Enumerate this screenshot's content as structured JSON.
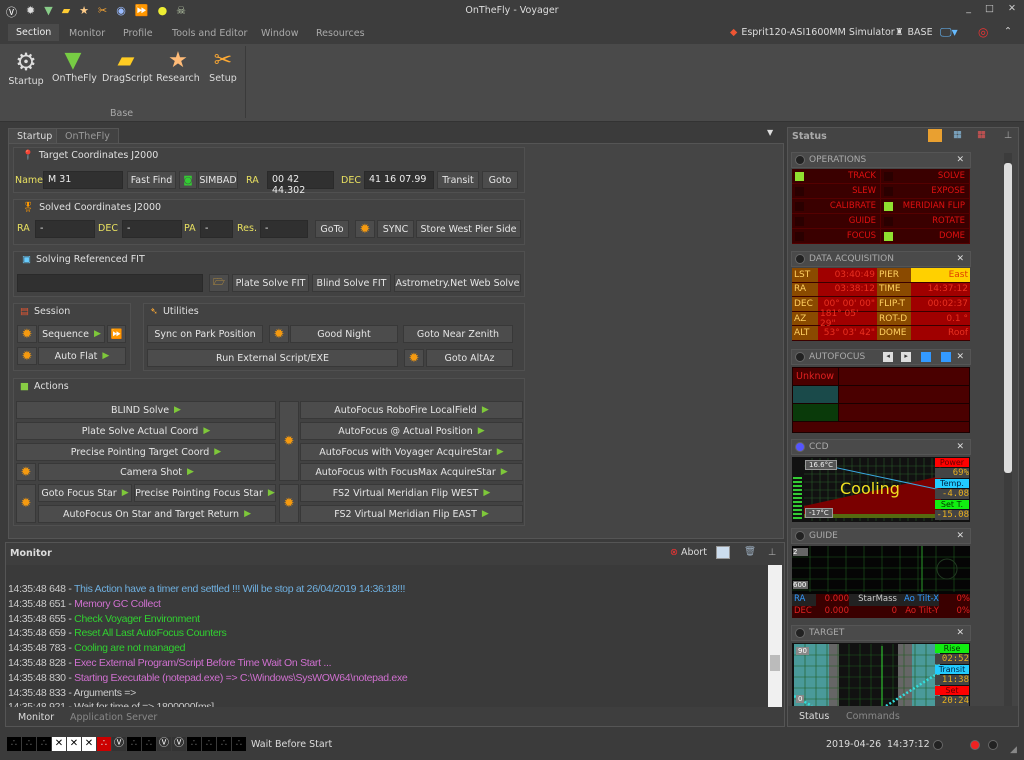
{
  "app": {
    "title": "OnTheFly - Voyager",
    "profile": "Esprit120-ASI1600MM Simulator",
    "base": "BASE"
  },
  "menu_tabs": [
    "Section",
    "Monitor",
    "Profile",
    "Tools and Editor",
    "Window",
    "Resources"
  ],
  "ribbon": {
    "items": [
      "Startup",
      "OnTheFly",
      "DragScript",
      "Research",
      "Setup"
    ],
    "group": "Base"
  },
  "doc_tabs": [
    "Startup",
    "OnTheFly"
  ],
  "target": {
    "header": "Target Coordinates J2000",
    "name_label": "Name",
    "name_value": "M 31",
    "fast_find": "Fast Find",
    "simbad": "SIMBAD",
    "ra_label": "RA",
    "ra_value": "00 42 44.302",
    "dec_label": "DEC",
    "dec_value": "41 16 07.99",
    "transit": "Transit",
    "goto": "Goto"
  },
  "solved": {
    "header": "Solved Coordinates J2000",
    "ra_label": "RA",
    "ra_value": "-",
    "dec_label": "DEC",
    "dec_value": "-",
    "pa_label": "PA",
    "pa_value": "-",
    "res_label": "Res.",
    "res_value": "-",
    "goto": "GoTo",
    "sync": "SYNC",
    "store": "Store  West Pier Side"
  },
  "fit": {
    "header": "Solving Referenced FIT",
    "path": "",
    "plate": "Plate Solve FIT",
    "blind": "Blind Solve FIT",
    "astrometry": "Astrometry.Net Web Solve"
  },
  "session": {
    "header": "Session",
    "sequence": "Sequence",
    "auto_flat": "Auto Flat"
  },
  "utilities": {
    "header": "Utilities",
    "sync_park": "Sync on Park Position",
    "good_night": "Good Night",
    "near_zenith": "Goto Near Zenith",
    "run_external": "Run External Script/EXE",
    "goto_altaz": "Goto AltAz"
  },
  "actions": {
    "header": "Actions",
    "left": [
      "BLIND Solve",
      "Plate Solve Actual Coord",
      "Precise Pointing Target Coord",
      "Camera Shot",
      "Goto Focus Star",
      "Precise Pointing Focus Star",
      "AutoFocus On Star and Target Return"
    ],
    "right": [
      "AutoFocus RoboFire LocalField",
      "AutoFocus @ Actual Position",
      "AutoFocus with Voyager AcquireStar",
      "AutoFocus with FocusMax AcquireStar",
      "FS2 Virtual Meridian Flip WEST",
      "FS2 Virtual Meridian Flip EAST"
    ]
  },
  "monitor": {
    "title": "Monitor",
    "abort": "Abort",
    "tabs": [
      "Monitor",
      "Application Server"
    ],
    "log": [
      {
        "t": "14:35:48 648",
        "m": "This Action have a timer end settled !!! Will be stop at 26/04/2019 14:36:18!!!",
        "c": "#6fb0e0"
      },
      {
        "t": "14:35:48 651",
        "m": "Memory GC Collect",
        "c": "#d070d0"
      },
      {
        "t": "14:35:48 655",
        "m": "Check Voyager Environment",
        "c": "#30d030"
      },
      {
        "t": "14:35:48 659",
        "m": "Reset All Last AutoFocus Counters",
        "c": "#30d030"
      },
      {
        "t": "14:35:48 783",
        "m": "Cooling are not managed",
        "c": "#30d030"
      },
      {
        "t": "14:35:48 828",
        "m": "Exec External Program/Script Before Time Wait On Start ...",
        "c": "#d070d0"
      },
      {
        "t": "14:35:48 830",
        "m": "Starting Executable (notepad.exe) => C:\\Windows\\SysWOW64\\notepad.exe",
        "c": "#d070d0"
      },
      {
        "t": "14:35:48 833",
        "m": "Arguments =>",
        "c": "#cccccc"
      },
      {
        "t": "14:35:48 921",
        "m": "Wait for time of => 1800000[ms]",
        "c": "#cccccc"
      }
    ]
  },
  "status": {
    "title": "Status",
    "tabs": [
      "Status",
      "Commands"
    ],
    "operations": {
      "title": "OPERATIONS",
      "left": [
        {
          "l": "TRACK",
          "on": true
        },
        {
          "l": "SLEW",
          "on": false
        },
        {
          "l": "CALIBRATE",
          "on": false
        },
        {
          "l": "GUIDE",
          "on": false
        },
        {
          "l": "FOCUS",
          "on": false
        }
      ],
      "right": [
        {
          "l": "SOLVE",
          "on": false
        },
        {
          "l": "EXPOSE",
          "on": false
        },
        {
          "l": "MERIDIAN FLIP",
          "on": true
        },
        {
          "l": "ROTATE",
          "on": false
        },
        {
          "l": "DOME",
          "on": true
        }
      ]
    },
    "data_acq": {
      "title": "DATA ACQUISITION",
      "rows": [
        [
          "LST",
          "03:40:49",
          "PIER",
          "East"
        ],
        [
          "RA",
          "03:38:12",
          "TIME",
          "14:37:12"
        ],
        [
          "DEC",
          "00° 00' 00\"",
          "FLIP-T",
          "00:02:37"
        ],
        [
          "AZ",
          "181° 05' 29\"",
          "ROT-D",
          "0.1 °"
        ],
        [
          "ALT",
          "53° 03' 42\"",
          "DOME",
          "Roof"
        ]
      ]
    },
    "autofocus": {
      "title": "AUTOFOCUS",
      "state": "Unknow"
    },
    "ccd": {
      "title": "CCD",
      "top": "16.6°C",
      "bottom": "-17°C",
      "state": "Cooling",
      "power_label": "Power",
      "power": "69%",
      "temp_label": "Temp.",
      "temp": "-4.08",
      "set_label": "Set T.",
      "set": "-15.08"
    },
    "guide": {
      "title": "GUIDE",
      "scale_top": "2",
      "scale_bottom": "600",
      "ra_label": "RA",
      "ra": "0.000",
      "dec_label": "DEC",
      "dec": "0.000",
      "starmass_label": "StarMass",
      "starmass": "0",
      "tiltx_label": "Ao Tilt-X",
      "tiltx": "0%",
      "tilty_label": "Ao Tilt-Y",
      "tilty": "0%"
    },
    "target": {
      "title": "TARGET",
      "alt_top": "90",
      "alt_bottom": "0",
      "rise_label": "Rise",
      "rise": "02:52",
      "transit_label": "Transit",
      "transit": "11:38",
      "set_label": "Set",
      "set": "20:24"
    }
  },
  "statusbar": {
    "message": "Wait Before Start",
    "date": "2019-04-26",
    "time": "14:37:12"
  }
}
